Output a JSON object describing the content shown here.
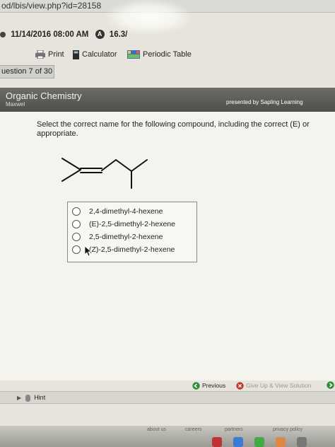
{
  "browser": {
    "url": "od/lbis/view.php?id=28158"
  },
  "info_bar": {
    "date_time": "11/14/2016 08:00 AM",
    "score_badge": "A",
    "score": "16.3/"
  },
  "toolbar": {
    "print": "Print",
    "calculator": "Calculator",
    "periodic_table": "Periodic Table"
  },
  "question_nav": {
    "label": "uestion 7 of 30"
  },
  "header": {
    "title": "Organic Chemistry",
    "subtitle": "Maxwel",
    "presented_by": "presented by Sapling Learning"
  },
  "question": {
    "prompt_line1": "Select the correct name for the following compound, including the correct (E) or",
    "prompt_line2": "appropriate."
  },
  "choices": [
    {
      "label": "2,4-dimethyl-4-hexene"
    },
    {
      "label": "(E)-2,5-dimethyl-2-hexene"
    },
    {
      "label": "2,5-dimethyl-2-hexene"
    },
    {
      "label": "(Z)-2,5-dimethyl-2-hexene"
    }
  ],
  "nav_links": {
    "previous": "Previous",
    "give_up": "Give Up & View Solution"
  },
  "hint": {
    "label": "Hint"
  },
  "footer": {
    "links": [
      "about us",
      "careers",
      "partners",
      "privacy policy"
    ]
  },
  "colors": {
    "header_bg": "#5a5a57",
    "previous_icon": "#2e8b3a",
    "giveup_icon": "#c0392b"
  }
}
